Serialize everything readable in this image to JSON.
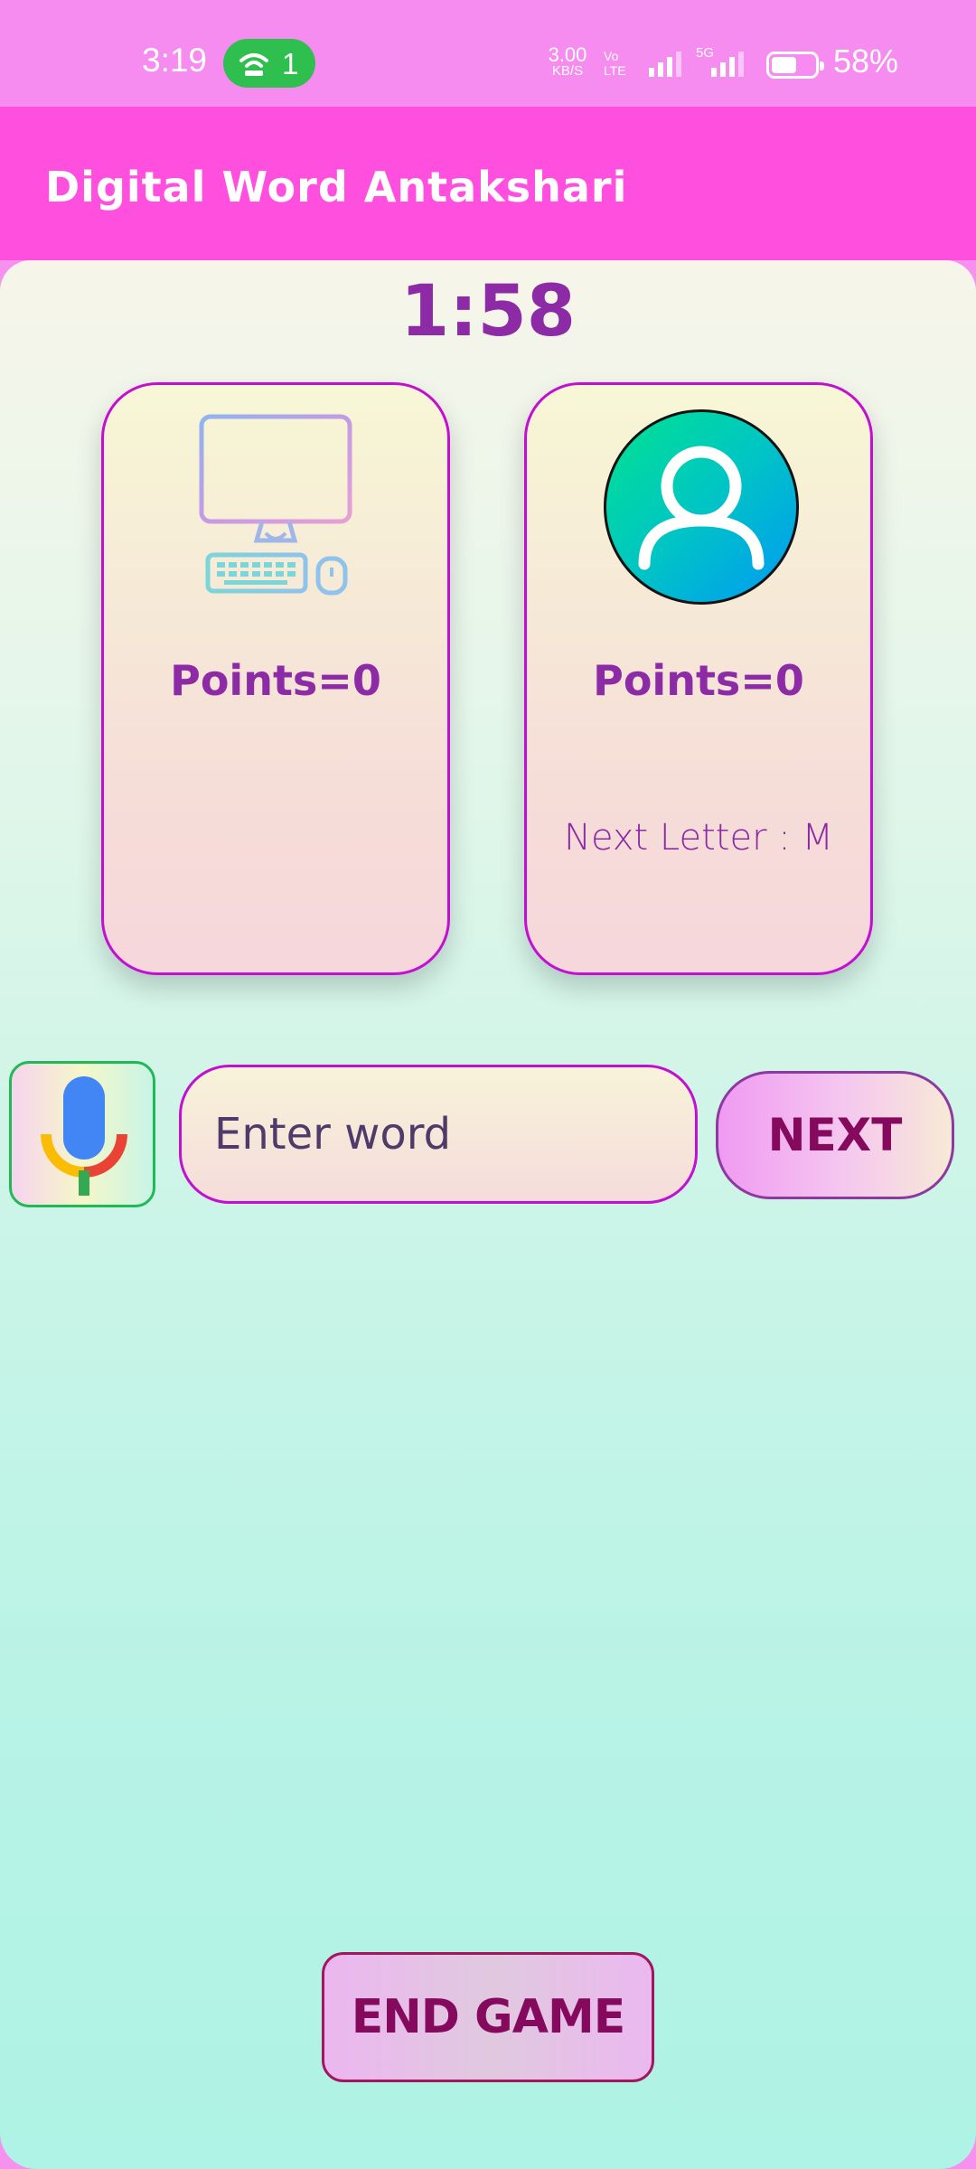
{
  "status_bar": {
    "time": "3:19",
    "hotspot_count": "1",
    "speed_value": "3.00",
    "speed_unit": "KB/S",
    "volte_top": "Vo",
    "volte_bottom": "LTE",
    "network_5g": "5G",
    "battery_percent": "58%",
    "battery_level": 0.58,
    "pill_color": "#2fbf4f"
  },
  "app_bar": {
    "title": "Digital Word Antakshari",
    "color": "#ff4fdf"
  },
  "game": {
    "timer": "1:58",
    "computer": {
      "icon": "computer-icon",
      "points": "Points=0"
    },
    "player": {
      "icon": "user-avatar-icon",
      "points": "Points=0",
      "next_letter": "Next Letter : M"
    }
  },
  "input_row": {
    "mic_icon": "microphone-icon",
    "word_placeholder": "Enter word",
    "word_value": "",
    "next_label": "NEXT"
  },
  "footer": {
    "end_label": "END GAME"
  }
}
